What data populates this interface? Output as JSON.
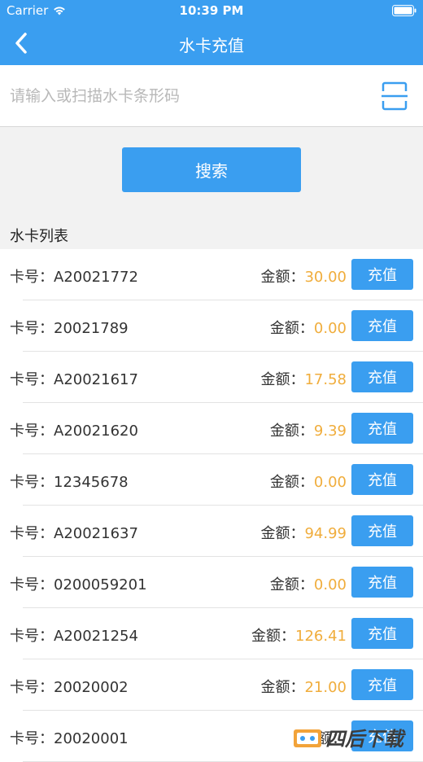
{
  "status_bar": {
    "carrier": "Carrier",
    "time": "10:39 PM"
  },
  "nav": {
    "title": "水卡充值"
  },
  "search": {
    "placeholder": "请输入或扫描水卡条形码",
    "button_label": "搜索"
  },
  "list": {
    "title": "水卡列表",
    "card_label": "卡号：",
    "amount_label": "金额：",
    "button_label": "充值",
    "items": [
      {
        "card_no": "A20021772",
        "amount": "30.00"
      },
      {
        "card_no": "20021789",
        "amount": "0.00"
      },
      {
        "card_no": "A20021617",
        "amount": "17.58"
      },
      {
        "card_no": "A20021620",
        "amount": "9.39"
      },
      {
        "card_no": "12345678",
        "amount": "0.00"
      },
      {
        "card_no": "A20021637",
        "amount": "94.99"
      },
      {
        "card_no": "0200059201",
        "amount": "0.00"
      },
      {
        "card_no": "A20021254",
        "amount": "126.41"
      },
      {
        "card_no": "20020002",
        "amount": "21.00"
      },
      {
        "card_no": "20020001",
        "amount": ""
      }
    ]
  },
  "watermark": {
    "text": "四后下载"
  },
  "colors": {
    "primary": "#3a9ef0",
    "amount": "#f0ad3c"
  }
}
